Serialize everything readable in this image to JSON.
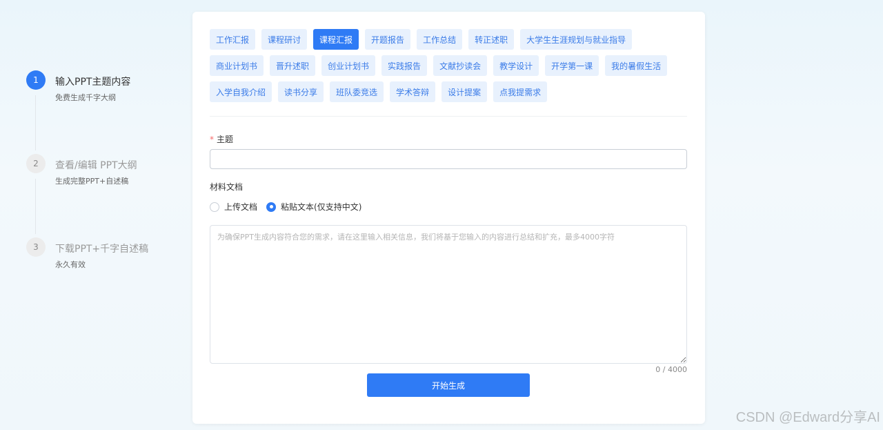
{
  "steps": [
    {
      "num": "1",
      "title": "输入PPT主题内容",
      "sub": "免费生成千字大纲"
    },
    {
      "num": "2",
      "title": "查看/编辑 PPT大纲",
      "sub": "生成完整PPT+自述稿"
    },
    {
      "num": "3",
      "title": "下载PPT+千字自述稿",
      "sub": "永久有效"
    }
  ],
  "tags": {
    "row1": [
      "工作汇报",
      "课程研讨",
      "课程汇报",
      "开题报告",
      "工作总结",
      "转正述职",
      "大学生生涯规划与就业指导"
    ],
    "row2": [
      "商业计划书",
      "晋升述职",
      "创业计划书",
      "实践报告",
      "文献抄读会",
      "教学设计",
      "开学第一课",
      "我的暑假生活"
    ],
    "row3": [
      "入学自我介绍",
      "读书分享",
      "班队委竞选",
      "学术答辩",
      "设计提案",
      "点我提需求"
    ],
    "active": "课程汇报"
  },
  "form": {
    "required_mark": "*",
    "subject_label": "主题",
    "subject_value": "",
    "material_label": "材料文档",
    "radio_upload": "上传文档",
    "radio_paste": "粘贴文本(仅支持中文)",
    "textarea_placeholder": "为确保PPT生成内容符合您的需求，请在这里输入相关信息，我们将基于您输入的内容进行总结和扩充，最多4000字符",
    "counter": "0 / 4000",
    "start_button": "开始生成"
  },
  "watermark": "CSDN @Edward分享AI",
  "colors": {
    "accent": "#2f7bf5",
    "tag_bg": "#e8f1fd",
    "tag_text": "#3b7ce8"
  }
}
